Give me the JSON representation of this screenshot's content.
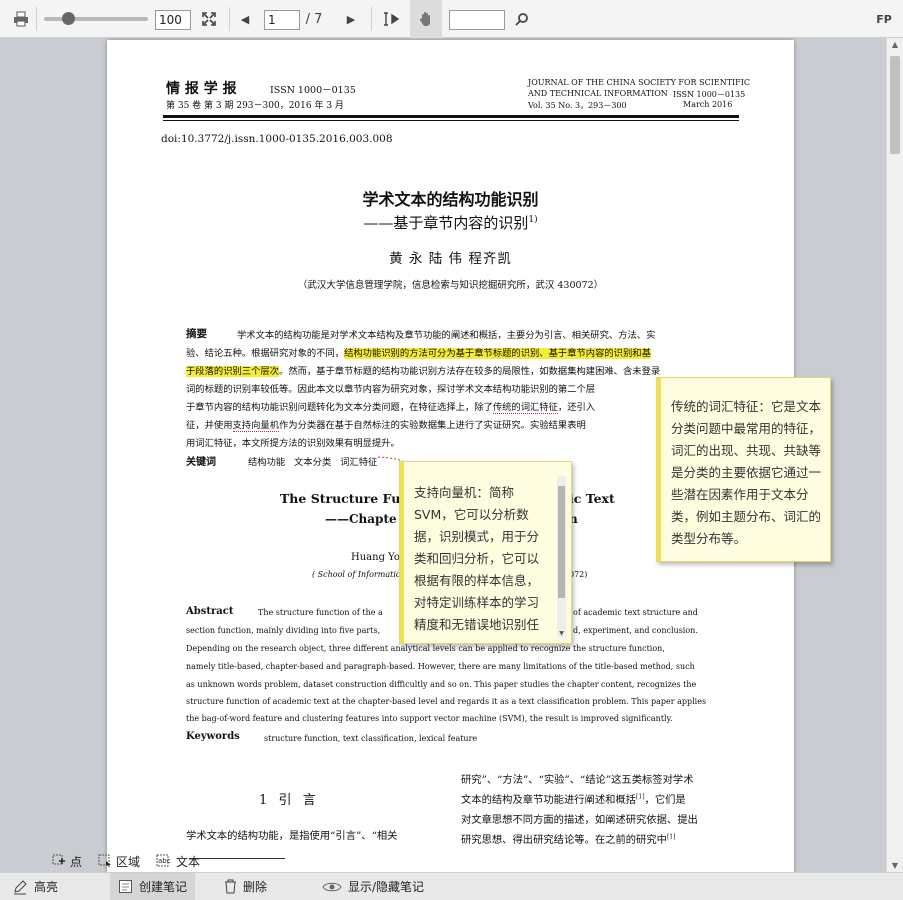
{
  "toolbar": {
    "zoom_value": "100",
    "page_input": "1",
    "page_total": "/ 7",
    "search_value": "",
    "fp_label": "FP"
  },
  "paper": {
    "journal_cn": "情 报 学 报",
    "issn_cn": "ISSN 1000－0135",
    "vol_cn": "第 35 卷 第 3 期 293－300，2016 年 3 月",
    "journal_en_1": "JOURNAL OF THE CHINA SOCIETY FOR SCIENTIFIC",
    "journal_en_2": "AND TECHNICAL INFORMATION",
    "issn_en": "ISSN 1000－0135",
    "vol_en": "Vol. 35   No. 3，293－300",
    "date_en": "March   2016",
    "doi": "doi:10.3772/j.issn.1000-0135.2016.003.008",
    "title_cn": "学术文本的结构功能识别",
    "subtitle_cn": "——基于章节内容的识别",
    "subtitle_sup": "1)",
    "authors_cn": "黄  永   陆  伟   程齐凯",
    "affil_cn": "（武汉大学信息管理学院，信息检索与知识挖掘研究所，武汉  430072）",
    "abstract_label": "摘要",
    "abstract_l1": "学术文本的结构功能是对学术文本结构及章节功能的阐述和概括，主要分为引言、相关研究、方法、实",
    "abstract_l2a": "验、结论五种。根据研究对象的不同，",
    "abstract_l2b": "结构功能识别的方法可分为基于章节标题的识别、基于章节内容的识别和基",
    "abstract_l3a": "于段落的识别三个层次",
    "abstract_l3b": "。然而，基于章节标题的结构功能识别方法存在较多的局限性，如数据集构建困难、含未登录",
    "abstract_l4": "词的标题的识别率较低等。因此本文以章节内容为研究对象，探讨学术文本结构功能识别的第二个层",
    "abstract_l5": "于章节内容的结构功能识别问题转化为文本分类问题，在特征选择上，除了",
    "abstract_l5b": "传统的词汇特征",
    "abstract_l5c": "，还引入",
    "abstract_l6a": "征，并使用",
    "abstract_l6b": "支持向量机",
    "abstract_l6c": "作为分类器在基于自然标注的实验数据集上进行了实证研究。实验结果表明",
    "abstract_l7": "用词汇特征，本文所提方法的识别效果有明显提升。",
    "keywords_label": "关键词",
    "keywords_cn": "结构功能   文本分类   词汇特征",
    "title_en_a": "The Structure Fun",
    "title_en_b": "ic Text",
    "subtitle_en_a": "——Chapte",
    "subtitle_en_b": "n",
    "authors_en": "Huang Yo",
    "affil_en_a": "( School of Information",
    "affil_en_b": "072)",
    "abstract_en_label": "Abstract",
    "abstract_en_l1a": "The structure function of the a",
    "abstract_en_l1b": "of academic text structure and",
    "abstract_en_l2a": "section function, mainly dividing into five parts,",
    "abstract_en_l2b": "d, experiment, and conclusion.",
    "abstract_en_l3": "Depending on the research object, three different analytical levels can be applied to recognize the structure function,",
    "abstract_en_l4": "namely title-based, chapter-based and paragraph-based. However, there are many limitations of the title-based method, such",
    "abstract_en_l5": "as unknown words problem, dataset construction difficultly and so on. This paper studies the chapter content, recognizes the",
    "abstract_en_l6": "structure function of academic text at the chapter-based level and regards it as a text classification problem. This paper applies",
    "abstract_en_l7": "the bag-of-word feature and clustering features into support vector machine (SVM), the result is improved significantly.",
    "keywords_en_label": "Keywords",
    "keywords_en": "structure function, text classification, lexical feature",
    "section_heading": "1  引  言",
    "body_left": "学术文本的结构功能，是指使用“引言”、“相关",
    "body_right_1": "研究”、“方法”、“实验”、“结论”这五类标签对学术",
    "body_right_2": "文本的结构及章节功能进行阐述和概括",
    "body_right_2b": "，它们是",
    "body_right_3": "对文章思想不同方面的描述，如阐述研究依据、提出",
    "body_right_4": "研究思想、得出研究结论等。在之前的研究中",
    "cite_1": "[1]"
  },
  "notes": {
    "svm": "支持向量机：简称SVM，它可以分析数据，识别模式，用于分类和回归分析，它可以根据有限的样本信息，对特定训练样本的学习精度和无错误地识别任",
    "lexical": "传统的词汇特征：它是文本分类问题中最常用的特征，词汇的出现、共现、共缺等是分类的主要依据它通过一些潜在因素作用于文本分类，例如主题分布、词汇的类型分布等。"
  },
  "modes": {
    "point": "点",
    "area": "区域",
    "text": "文本"
  },
  "bottom": {
    "highlight": "高亮",
    "create_note": "创建笔记",
    "delete": "删除",
    "toggle_notes": "显示/隐藏笔记"
  },
  "colors": {
    "highlight": "#f7ec35",
    "note_bg": "#fffde0"
  }
}
